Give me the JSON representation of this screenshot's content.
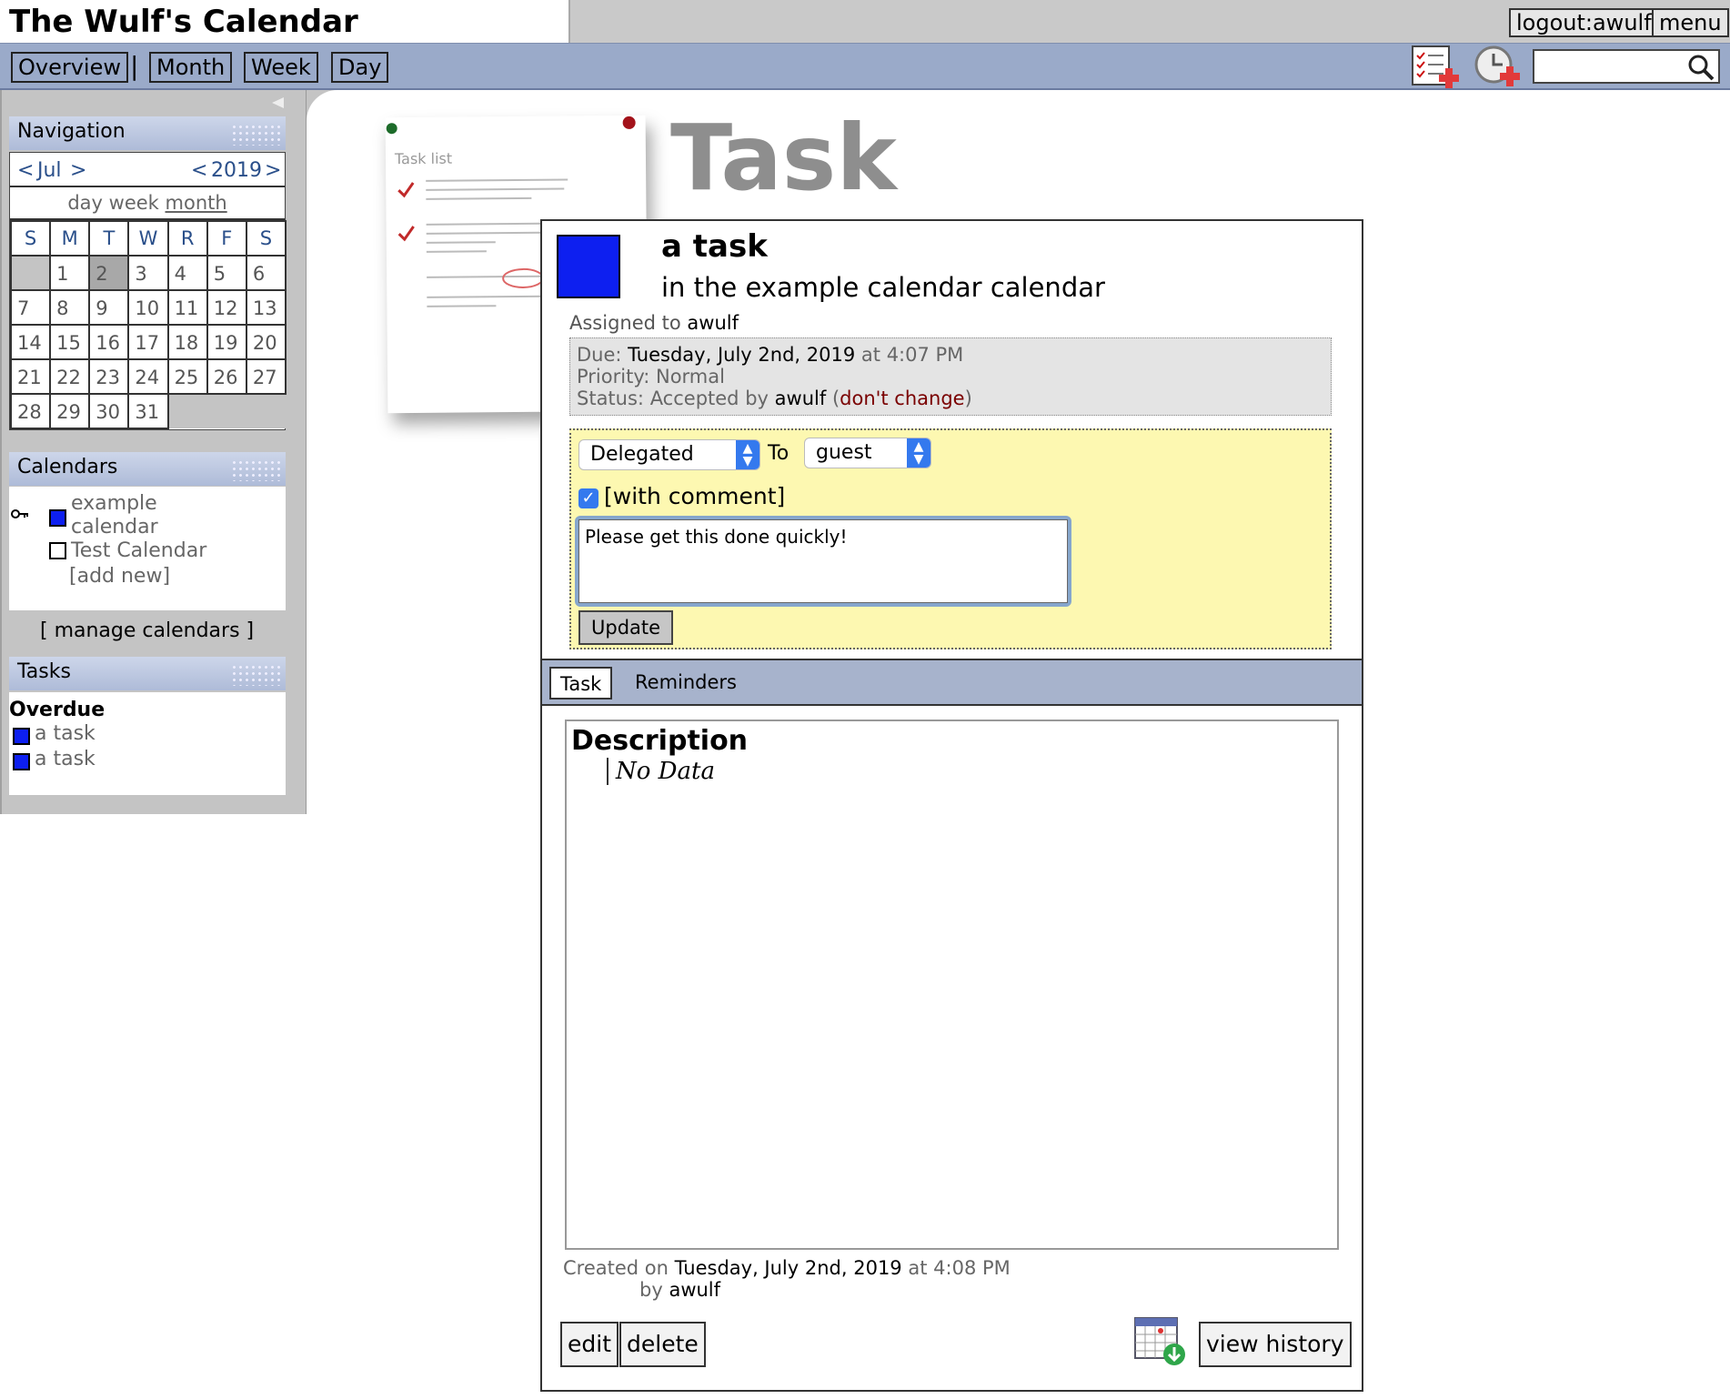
{
  "app": {
    "title": "The Wulf's Calendar",
    "logout_label": "logout:awulf",
    "menu_label": "menu"
  },
  "nav": {
    "tabs": [
      {
        "label": "Overview"
      },
      {
        "label": "Month"
      },
      {
        "label": "Week"
      },
      {
        "label": "Day"
      }
    ],
    "separator": "|",
    "new_task_icon": "add-task-icon",
    "new_event_icon": "add-event-icon",
    "search": {
      "placeholder": "",
      "value": "",
      "icon": "search-icon"
    }
  },
  "sidebar": {
    "collapse_icon": "collapse-arrow-icon",
    "navigation": {
      "heading": "Navigation",
      "month_prev": "<",
      "month": "Jul",
      "month_next": ">",
      "year_prev": "<",
      "year": "2019",
      "year_next": ">",
      "views": [
        "day",
        "week",
        "month"
      ],
      "weekdays": [
        "S",
        "M",
        "T",
        "W",
        "R",
        "F",
        "S"
      ],
      "weeks": [
        [
          "",
          "1",
          "2",
          "3",
          "4",
          "5",
          "6"
        ],
        [
          "7",
          "8",
          "9",
          "10",
          "11",
          "12",
          "13"
        ],
        [
          "14",
          "15",
          "16",
          "17",
          "18",
          "19",
          "20"
        ],
        [
          "21",
          "22",
          "23",
          "24",
          "25",
          "26",
          "27"
        ],
        [
          "28",
          "29",
          "30",
          "31",
          "",
          "",
          ""
        ]
      ],
      "today": "2"
    },
    "calendars": {
      "heading": "Calendars",
      "items": [
        {
          "name": "example calendar",
          "color": "#0d1ff0",
          "icon": "key-icon"
        },
        {
          "name": "Test Calendar",
          "color": "#ffffff"
        }
      ],
      "add_new": "[add new]",
      "manage": "[ manage calendars ]"
    },
    "tasks": {
      "heading": "Tasks",
      "group": "Overdue",
      "items": [
        {
          "label": "a task",
          "color": "#0d1ff0"
        },
        {
          "label": "a task",
          "color": "#0d1ff0"
        }
      ]
    }
  },
  "page": {
    "heading": "Task",
    "note_title": "Task list"
  },
  "task": {
    "color": "#0d1ff0",
    "title": "a task",
    "subtitle": "in the example calendar calendar",
    "assigned_label": "Assigned to",
    "assigned_to": "awulf",
    "due_label": "Due:",
    "due_date": "Tuesday, July 2nd, 2019",
    "at_label": "at",
    "due_time": "4:07 PM",
    "priority_label": "Priority:",
    "priority": "Normal",
    "status_label": "Status:",
    "status": "Accepted",
    "by_label": "by",
    "status_by": "awulf",
    "dont_change": "don't change",
    "status_form": {
      "status_value": "Delegated",
      "to_label": "To",
      "to_value": "guest",
      "comment_checked": true,
      "comment_label": "[with comment]",
      "comment_text": "Please get this done quickly!",
      "update_label": "Update"
    },
    "tabs": [
      {
        "label": "Task",
        "active": true
      },
      {
        "label": "Reminders",
        "active": false
      }
    ],
    "description_title": "Description",
    "description": "No Data",
    "created_label": "Created on",
    "created_date": "Tuesday, July 2nd, 2019",
    "created_at_label": "at",
    "created_time": "4:08 PM",
    "created_by_label": "by",
    "created_by": "awulf",
    "buttons": {
      "edit": "edit",
      "delete": "delete",
      "export_icon": "calendar-download-icon",
      "history": "view history"
    }
  },
  "colors": {
    "nav_bar": "#9aaac9",
    "panel_header": "#aebbd8",
    "status_box": "#fdf8b1",
    "accent_blue": "#3479ee",
    "task_blue": "#0d1ff0"
  }
}
